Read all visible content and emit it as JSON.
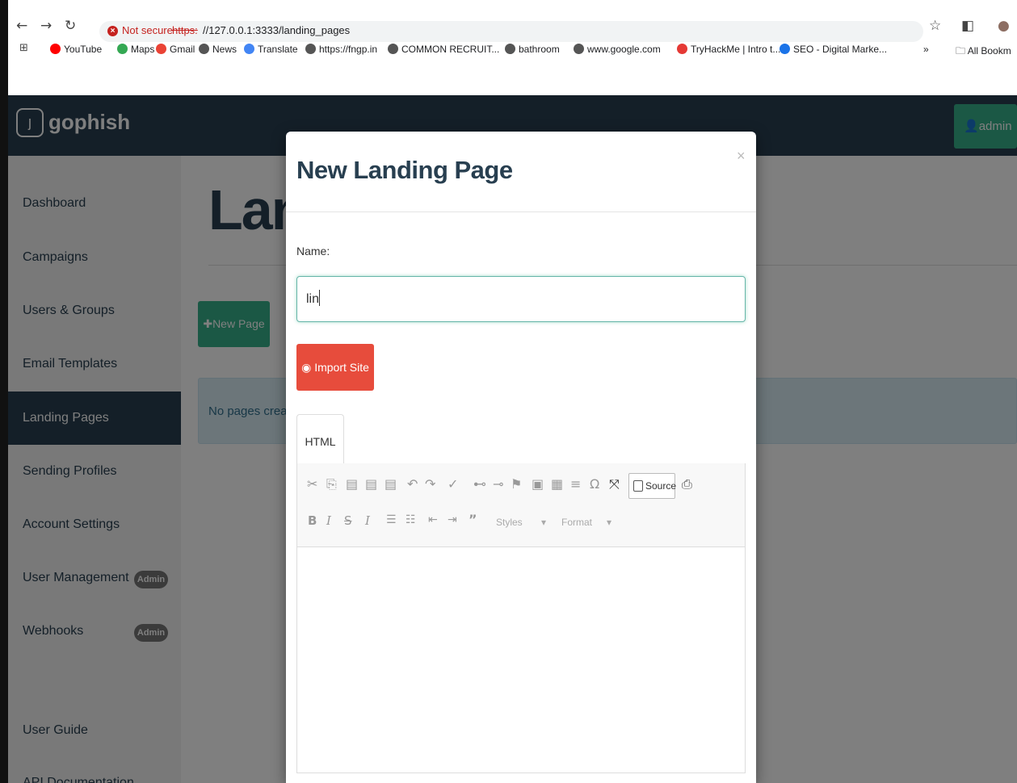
{
  "browser": {
    "not_secure": "Not secure",
    "url_scheme": "https:",
    "url_rest": "//127.0.0.1:3333/landing_pages",
    "bookmarks": [
      {
        "label": "YouTube",
        "color": "#ff0000"
      },
      {
        "label": "Maps",
        "color": "#34a853"
      },
      {
        "label": "Gmail",
        "color": "#ea4335"
      },
      {
        "label": "News",
        "color": "#555555"
      },
      {
        "label": "Translate",
        "color": "#4285f4"
      },
      {
        "label": "https://fngp.in",
        "color": "#555555"
      },
      {
        "label": "COMMON RECRUIT...",
        "color": "#555555"
      },
      {
        "label": "bathroom",
        "color": "#555555"
      },
      {
        "label": "www.google.com",
        "color": "#555555"
      },
      {
        "label": "TryHackMe | Intro t...",
        "color": "#e53935"
      },
      {
        "label": "SEO - Digital Marke...",
        "color": "#1a73e8"
      }
    ],
    "all_bookmarks": "All Bookm"
  },
  "app": {
    "brand": "gophish",
    "admin_label": "admin",
    "sidebar": [
      "Dashboard",
      "Campaigns",
      "Users & Groups",
      "Email Templates",
      "Landing Pages",
      "Sending Profiles",
      "Account Settings",
      "User Management",
      "Webhooks",
      "User Guide",
      "API Documentation"
    ],
    "admin_badge": "Admin",
    "page_title": "Landing Pages",
    "new_page_label": "New Page",
    "no_pages": "No pages created yet. Let's create one!"
  },
  "modal": {
    "title": "New Landing Page",
    "close": "×",
    "name_label": "Name:",
    "name_value": "lin",
    "import_label": "Import Site",
    "tab_html": "HTML",
    "source_label": "Source",
    "styles_label": "Styles",
    "format_label": "Format"
  },
  "colors": {
    "navbar": "#283f50",
    "accent_green": "#37b18a",
    "import_red": "#e74c3c",
    "info_bg": "#d9ecf5"
  }
}
